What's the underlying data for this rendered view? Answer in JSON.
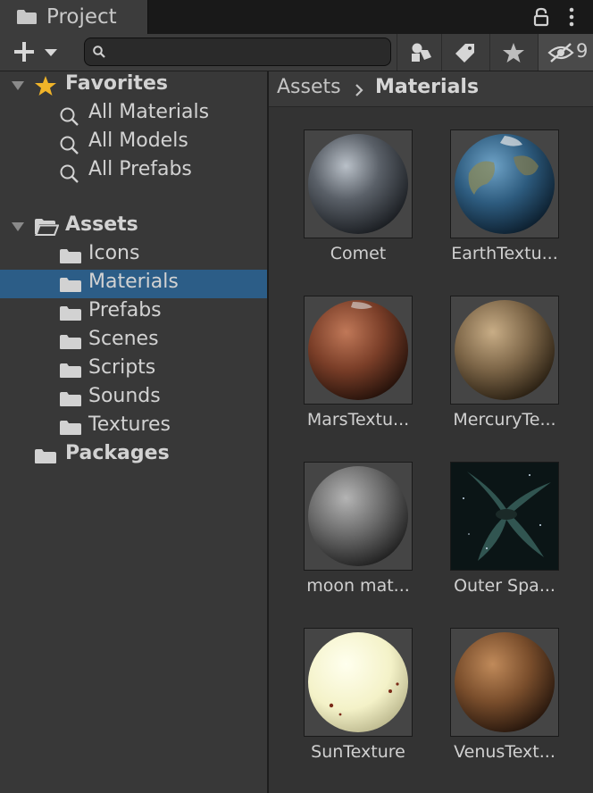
{
  "window": {
    "tab_label": "Project",
    "hidden_count": "9"
  },
  "search": {
    "value": "",
    "placeholder": ""
  },
  "toolbar": {
    "create_icon": "plus-icon",
    "filter_type_icon": "shapes-icon",
    "filter_label_icon": "tag-icon",
    "favorite_icon": "star-icon",
    "hidden_packages_icon": "eye-slash-icon"
  },
  "sidebar": {
    "favorites": {
      "label": "Favorites",
      "items": [
        {
          "label": "All Materials"
        },
        {
          "label": "All Models"
        },
        {
          "label": "All Prefabs"
        }
      ]
    },
    "assets": {
      "label": "Assets",
      "folders": [
        {
          "label": "Icons",
          "selected": false
        },
        {
          "label": "Materials",
          "selected": true
        },
        {
          "label": "Prefabs",
          "selected": false
        },
        {
          "label": "Scenes",
          "selected": false
        },
        {
          "label": "Scripts",
          "selected": false
        },
        {
          "label": "Sounds",
          "selected": false
        },
        {
          "label": "Textures",
          "selected": false
        }
      ]
    },
    "packages": {
      "label": "Packages"
    }
  },
  "breadcrumb": {
    "root": "Assets",
    "current": "Materials"
  },
  "assets": [
    {
      "label": "Comet",
      "color": "#5a6068"
    },
    {
      "label": "EarthTextu...",
      "color": "#2d5b7e"
    },
    {
      "label": "MarsTextu...",
      "color": "#7a3e28"
    },
    {
      "label": "MercuryTe...",
      "color": "#7d6648"
    },
    {
      "label": "moon mat...",
      "color": "#6a6a6a"
    },
    {
      "label": "Outer Spa...",
      "color": "#0b1516"
    },
    {
      "label": "SunTexture",
      "color": "#f4f2c8"
    },
    {
      "label": "VenusText...",
      "color": "#7a4e2c"
    }
  ],
  "colors": {
    "selection": "#2c5d87",
    "star": "#f0b429"
  }
}
